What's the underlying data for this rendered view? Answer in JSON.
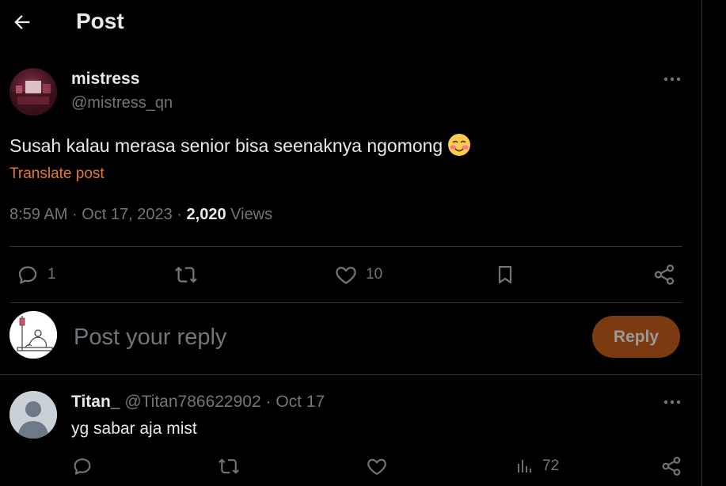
{
  "header": {
    "title": "Post"
  },
  "post": {
    "display_name": "mistress",
    "handle": "@mistress_qn",
    "text": "Susah kalau merasa senior bisa seenaknya ngomong",
    "translate_label": "Translate post",
    "time": "8:59 AM",
    "date": "Oct 17, 2023",
    "separator": "·",
    "views_count": "2,020",
    "views_label": "Views",
    "actions": {
      "reply_count": "1",
      "repost_count": "",
      "like_count": "10"
    }
  },
  "reply_box": {
    "placeholder": "Post your reply",
    "button_label": "Reply"
  },
  "comment": {
    "display_name": "Titan_",
    "handle": "@Titan786622902",
    "separator": "·",
    "date": "Oct 17",
    "text": "yg sabar aja mist",
    "views_count": "72"
  },
  "colors": {
    "accent": "#e8782c",
    "reply_button_bg": "#7b3a10",
    "muted": "#71767b",
    "background": "#000000"
  },
  "icons": [
    "back-arrow-icon",
    "more-icon",
    "blush-emoji-icon",
    "reply-icon",
    "repost-icon",
    "like-icon",
    "bookmark-icon",
    "share-icon",
    "views-icon"
  ]
}
